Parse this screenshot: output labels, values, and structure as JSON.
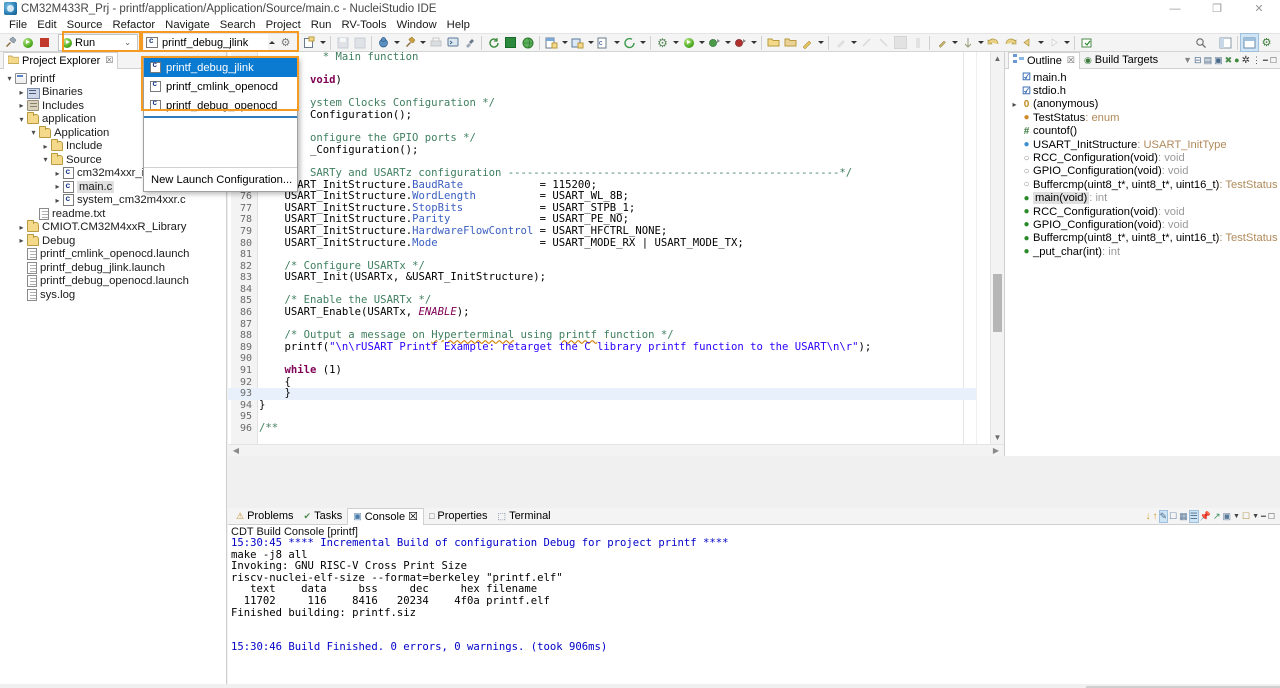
{
  "window": {
    "title": "CM32M433R_Prj - printf/application/Application/Source/main.c - NucleiStudio IDE",
    "app_icon": "nuclei-studio-icon",
    "controls": {
      "minimize": "—",
      "maximize": "❐",
      "close": "✕"
    }
  },
  "menubar": {
    "items": [
      "File",
      "Edit",
      "Source",
      "Refactor",
      "Navigate",
      "Search",
      "Project",
      "Run",
      "RV-Tools",
      "Window",
      "Help"
    ]
  },
  "toolbar": {
    "mode_combo": {
      "label": "Run",
      "icon": "run-green-icon",
      "caret": "⌄"
    },
    "launch_combo": {
      "label": "printf_debug_jlink",
      "icon": "launch-config-icon",
      "caret": "⌃",
      "gear": "⚙"
    },
    "new_label": "New",
    "highlight_color": "#f59a23"
  },
  "launch_dropdown": {
    "items": [
      {
        "label": "printf_debug_jlink",
        "selected": true
      },
      {
        "label": "printf_cmlink_openocd",
        "selected": false
      },
      {
        "label": "printf_debug_openocd",
        "selected": false
      }
    ],
    "footer": "New Launch Configuration...",
    "selection_color": "#0b7ad1"
  },
  "project_explorer": {
    "tab_label": "Project Explorer",
    "tab_close": "☒",
    "tree": [
      {
        "label": "printf",
        "indent": 0,
        "twisty": "v",
        "icon": "project-icon",
        "selected": false
      },
      {
        "label": "Binaries",
        "indent": 1,
        "twisty": ">",
        "icon": "binaries-icon",
        "selected": false
      },
      {
        "label": "Includes",
        "indent": 1,
        "twisty": ">",
        "icon": "includes-icon",
        "selected": false
      },
      {
        "label": "application",
        "indent": 1,
        "twisty": "v",
        "icon": "folder-icon",
        "selected": false
      },
      {
        "label": "Application",
        "indent": 2,
        "twisty": "v",
        "icon": "folder-icon",
        "selected": false
      },
      {
        "label": "Include",
        "indent": 3,
        "twisty": ">",
        "icon": "folder-icon",
        "selected": false
      },
      {
        "label": "Source",
        "indent": 3,
        "twisty": "v",
        "icon": "folder-icon",
        "selected": false
      },
      {
        "label": "cm32m4xxr_it.c",
        "indent": 4,
        "twisty": ">",
        "icon": "c-file-icon",
        "selected": false
      },
      {
        "label": "main.c",
        "indent": 4,
        "twisty": ">",
        "icon": "c-file-icon",
        "selected": true
      },
      {
        "label": "system_cm32m4xxr.c",
        "indent": 4,
        "twisty": ">",
        "icon": "c-file-icon",
        "selected": false
      },
      {
        "label": "readme.txt",
        "indent": 2,
        "twisty": "",
        "icon": "file-icon",
        "selected": false
      },
      {
        "label": "CMIOT.CM32M4xxR_Library",
        "indent": 1,
        "twisty": ">",
        "icon": "folder-icon",
        "selected": false
      },
      {
        "label": "Debug",
        "indent": 1,
        "twisty": ">",
        "icon": "folder-icon",
        "selected": false
      },
      {
        "label": "printf_cmlink_openocd.launch",
        "indent": 1,
        "twisty": "",
        "icon": "file-icon",
        "selected": false
      },
      {
        "label": "printf_debug_jlink.launch",
        "indent": 1,
        "twisty": "",
        "icon": "file-icon",
        "selected": false
      },
      {
        "label": "printf_debug_openocd.launch",
        "indent": 1,
        "twisty": "",
        "icon": "file-icon",
        "selected": false
      },
      {
        "label": "sys.log",
        "indent": 1,
        "twisty": "",
        "icon": "file-icon",
        "selected": false
      }
    ]
  },
  "editor": {
    "file": "main.c",
    "first_visible_line": 63,
    "highlighted_line": 93,
    "lines": [
      {
        "n": 63,
        "html": "<span class='k-cmt'>  * Main function</span>"
      },
      {
        "n": 64,
        "html": ""
      },
      {
        "n": 65,
        "html": "<span class='k-kw'>void</span>)"
      },
      {
        "n": 66,
        "html": ""
      },
      {
        "n": 67,
        "html": "<span class='k-cmt'>ystem Clocks Configuration */</span>"
      },
      {
        "n": 68,
        "html": "Configuration();"
      },
      {
        "n": 69,
        "html": ""
      },
      {
        "n": 70,
        "html": "<span class='k-cmt'>onfigure the GPIO ports */</span>"
      },
      {
        "n": 71,
        "html": "_Configuration();"
      },
      {
        "n": 72,
        "html": ""
      },
      {
        "n": 73,
        "html": "<span class='k-cmt'>SARTy and USARTz configuration ----------------------------------------------------*/</span>"
      },
      {
        "n": 75,
        "html": "    USART_InitStructure.<span class='k-fld'>BaudRate</span>            = 115200;"
      },
      {
        "n": 76,
        "html": "    USART_InitStructure.<span class='k-fld'>WordLength</span>          = USART_WL_8B;"
      },
      {
        "n": 77,
        "html": "    USART_InitStructure.<span class='k-fld'>StopBits</span>            = USART_STPB_1;"
      },
      {
        "n": 78,
        "html": "    USART_InitStructure.<span class='k-fld'>Parity</span>              = USART_PE_NO;"
      },
      {
        "n": 79,
        "html": "    USART_InitStructure.<span class='k-fld'>HardwareFlowControl</span> = USART_HFCTRL_NONE;"
      },
      {
        "n": 80,
        "html": "    USART_InitStructure.<span class='k-fld'>Mode</span>                = USART_MODE_RX | USART_MODE_TX;"
      },
      {
        "n": 81,
        "html": ""
      },
      {
        "n": 82,
        "html": "    <span class='k-cmt'>/* Configure USARTx */</span>"
      },
      {
        "n": 83,
        "html": "    USART_Init(USARTx, &amp;USART_InitStructure);"
      },
      {
        "n": 84,
        "html": ""
      },
      {
        "n": 85,
        "html": "    <span class='k-cmt'>/* Enable the USARTx */</span>"
      },
      {
        "n": 86,
        "html": "    USART_Enable(USARTx, <span class='k-it'>ENABLE</span>);"
      },
      {
        "n": 87,
        "html": ""
      },
      {
        "n": 88,
        "html": "    <span class='k-cmt'>/* Output a message on <span class='sq'>Hyperterminal</span> using <span class='sq'>printf</span> function */</span>"
      },
      {
        "n": 89,
        "html": "    printf(<span class='k-str'>\"\\n\\rUSART Printf Example: retarget the C library printf function to the USART\\n\\r\"</span>);"
      },
      {
        "n": 90,
        "html": ""
      },
      {
        "n": 91,
        "html": "    <span class='k-kw'>while</span> (1)"
      },
      {
        "n": 92,
        "html": "    {"
      },
      {
        "n": 93,
        "html": "    }"
      },
      {
        "n": 94,
        "html": "}"
      },
      {
        "n": 95,
        "html": ""
      },
      {
        "n": 96,
        "html": "<span class='k-cmt'>/**</span>"
      }
    ]
  },
  "outline": {
    "tabs": [
      {
        "label": "Outline",
        "active": true,
        "close": "☒"
      },
      {
        "label": "Build Targets",
        "active": false
      }
    ],
    "items": [
      {
        "label": "main.h",
        "glyph": "include-icon",
        "gcls": "gl-inc",
        "gtxt": "☑",
        "twisty": "",
        "type": "",
        "selected": false
      },
      {
        "label": "stdio.h",
        "glyph": "include-icon",
        "gcls": "gl-inc",
        "gtxt": "☑",
        "twisty": "",
        "type": "",
        "selected": false
      },
      {
        "label": "(anonymous)",
        "glyph": "anonymous-icon",
        "gcls": "gl-anon",
        "gtxt": "0",
        "twisty": ">",
        "type": "",
        "selected": false
      },
      {
        "label": "TestStatus",
        "glyph": "enum-icon",
        "gcls": "gl-enum",
        "gtxt": "●",
        "twisty": "",
        "type": " : enum",
        "typecls": "ol-type",
        "selected": false
      },
      {
        "label": "countof()",
        "glyph": "macro-icon",
        "gcls": "gl-def",
        "gtxt": "#",
        "twisty": "",
        "type": "",
        "selected": false
      },
      {
        "label": "USART_InitStructure",
        "glyph": "variable-icon",
        "gcls": "gl-var",
        "gtxt": "●",
        "twisty": "",
        "type": " : USART_InitType",
        "typecls": "ol-type",
        "selected": false
      },
      {
        "label": "RCC_Configuration(void)",
        "glyph": "prototype-icon",
        "gcls": "gl-proto",
        "gtxt": "○",
        "twisty": "",
        "type": " : void",
        "typecls": "ol-type2",
        "selected": false
      },
      {
        "label": "GPIO_Configuration(void)",
        "glyph": "prototype-icon",
        "gcls": "gl-proto",
        "gtxt": "○",
        "twisty": "",
        "type": " : void",
        "typecls": "ol-type2",
        "selected": false
      },
      {
        "label": "Buffercmp(uint8_t*, uint8_t*, uint16_t)",
        "glyph": "prototype-icon",
        "gcls": "gl-proto",
        "gtxt": "○",
        "twisty": "",
        "type": " : TestStatus",
        "typecls": "ol-type",
        "selected": false
      },
      {
        "label": "main(void)",
        "glyph": "function-icon",
        "gcls": "gl-fn",
        "gtxt": "●",
        "twisty": "",
        "type": " : int",
        "typecls": "ol-type2",
        "selected": true
      },
      {
        "label": "RCC_Configuration(void)",
        "glyph": "function-icon",
        "gcls": "gl-fn",
        "gtxt": "●",
        "twisty": "",
        "type": " : void",
        "typecls": "ol-type2",
        "selected": false
      },
      {
        "label": "GPIO_Configuration(void)",
        "glyph": "function-icon",
        "gcls": "gl-fn",
        "gtxt": "●",
        "twisty": "",
        "type": " : void",
        "typecls": "ol-type2",
        "selected": false
      },
      {
        "label": "Buffercmp(uint8_t*, uint8_t*, uint16_t)",
        "glyph": "function-icon",
        "gcls": "gl-fn",
        "gtxt": "●",
        "twisty": "",
        "type": " : TestStatus",
        "typecls": "ol-type",
        "selected": false
      },
      {
        "label": "_put_char(int)",
        "glyph": "function-icon",
        "gcls": "gl-fn",
        "gtxt": "●",
        "twisty": "",
        "type": " : int",
        "typecls": "ol-type2",
        "selected": false
      }
    ]
  },
  "console": {
    "tabs": [
      {
        "label": "Problems",
        "active": false,
        "icon": "problems-icon"
      },
      {
        "label": "Tasks",
        "active": false,
        "icon": "tasks-icon"
      },
      {
        "label": "Console",
        "active": true,
        "icon": "console-icon",
        "close": "☒"
      },
      {
        "label": "Properties",
        "active": false,
        "icon": "properties-icon"
      },
      {
        "label": "Terminal",
        "active": false,
        "icon": "terminal-icon"
      }
    ],
    "subtitle": "CDT Build Console [printf]",
    "output": [
      {
        "text": "15:30:45 **** Incremental Build of configuration Debug for project printf ****",
        "blue": true
      },
      {
        "text": "make -j8 all",
        "blue": false
      },
      {
        "text": "Invoking: GNU RISC-V Cross Print Size",
        "blue": false
      },
      {
        "text": "riscv-nuclei-elf-size --format=berkeley \"printf.elf\"",
        "blue": false
      },
      {
        "text": "   text    data     bss     dec     hex filename",
        "blue": false
      },
      {
        "text": "  11702     116    8416   20234    4f0a printf.elf",
        "blue": false
      },
      {
        "text": "Finished building: printf.siz",
        "blue": false
      },
      {
        "text": "",
        "blue": false
      },
      {
        "text": "",
        "blue": false
      },
      {
        "text": "15:30:46 Build Finished. 0 errors, 0 warnings. (took 906ms)",
        "blue": true
      }
    ]
  }
}
